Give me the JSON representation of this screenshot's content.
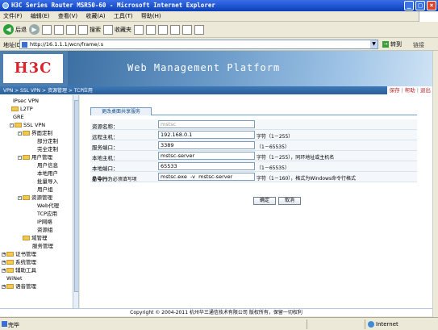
{
  "window": {
    "title": "H3C Series Router MSR50-60 - Microsoft Internet Explorer"
  },
  "menu": [
    "文件(F)",
    "编辑(E)",
    "查看(V)",
    "收藏(A)",
    "工具(T)",
    "帮助(H)"
  ],
  "toolbar": {
    "back": "后退",
    "search": "搜索",
    "favorites": "收藏夹"
  },
  "address": {
    "label": "地址(D)",
    "url": "http://16.1.1.1/wcn/frame/.s",
    "go": "转到",
    "links": "链接"
  },
  "banner": {
    "logo": "H3C",
    "title": "Web Management Platform"
  },
  "breadcrumb": "VPN > SSL VPN > 资源管理 > TCP应用",
  "toplinks": {
    "save": "保存",
    "help": "帮助",
    "logout": "退出",
    "sep": "|"
  },
  "tree": [
    {
      "label": "IPsec VPN"
    },
    {
      "label": "L2TP"
    },
    {
      "label": "GRE"
    },
    {
      "label": "SSL VPN"
    },
    {
      "label": "界面定制"
    },
    {
      "label": "部分定制"
    },
    {
      "label": "完全定制"
    },
    {
      "label": "用户管理"
    },
    {
      "label": "用户信息"
    },
    {
      "label": "本地用户"
    },
    {
      "label": "批量导入"
    },
    {
      "label": "用户组"
    },
    {
      "label": "资源管理"
    },
    {
      "label": "Web代理"
    },
    {
      "label": "TCP应用"
    },
    {
      "label": "IP网络"
    },
    {
      "label": "资源组"
    },
    {
      "label": "域管理"
    },
    {
      "label": "服务管理"
    },
    {
      "label": "证书管理"
    },
    {
      "label": "系统管理"
    },
    {
      "label": "辅助工具"
    },
    {
      "label": "WiNet"
    },
    {
      "label": "语音管理"
    }
  ],
  "form": {
    "tab": "更改桌面共享服务",
    "rows": [
      {
        "label": "资源名称：",
        "value": "mstsc",
        "hint": ""
      },
      {
        "label": "远程主机：",
        "value": "192.168.0.1",
        "hint": "字符（1－255）"
      },
      {
        "label": "服务端口：",
        "value": "3389",
        "hint": "（1－65535）"
      },
      {
        "label": "本地主机：",
        "value": "mstsc-server",
        "hint": "字符（1－255），同环地址或主机名"
      },
      {
        "label": "本地端口：",
        "value": "65533",
        "hint": "（1－65535）"
      },
      {
        "label": "命令行：",
        "value": "mstsc.exe  -v  mstsc-server",
        "hint": "字符（1－160），格式为Windows命令行格式"
      }
    ],
    "note": "星号(*)为必须填写项",
    "ok": "确定",
    "cancel": "取消"
  },
  "footer": "Copyright © 2004-2011 杭州华三通信技术有限公司 版权所有，保留一切权利",
  "status": {
    "left": "完毕",
    "zone": "Internet"
  }
}
